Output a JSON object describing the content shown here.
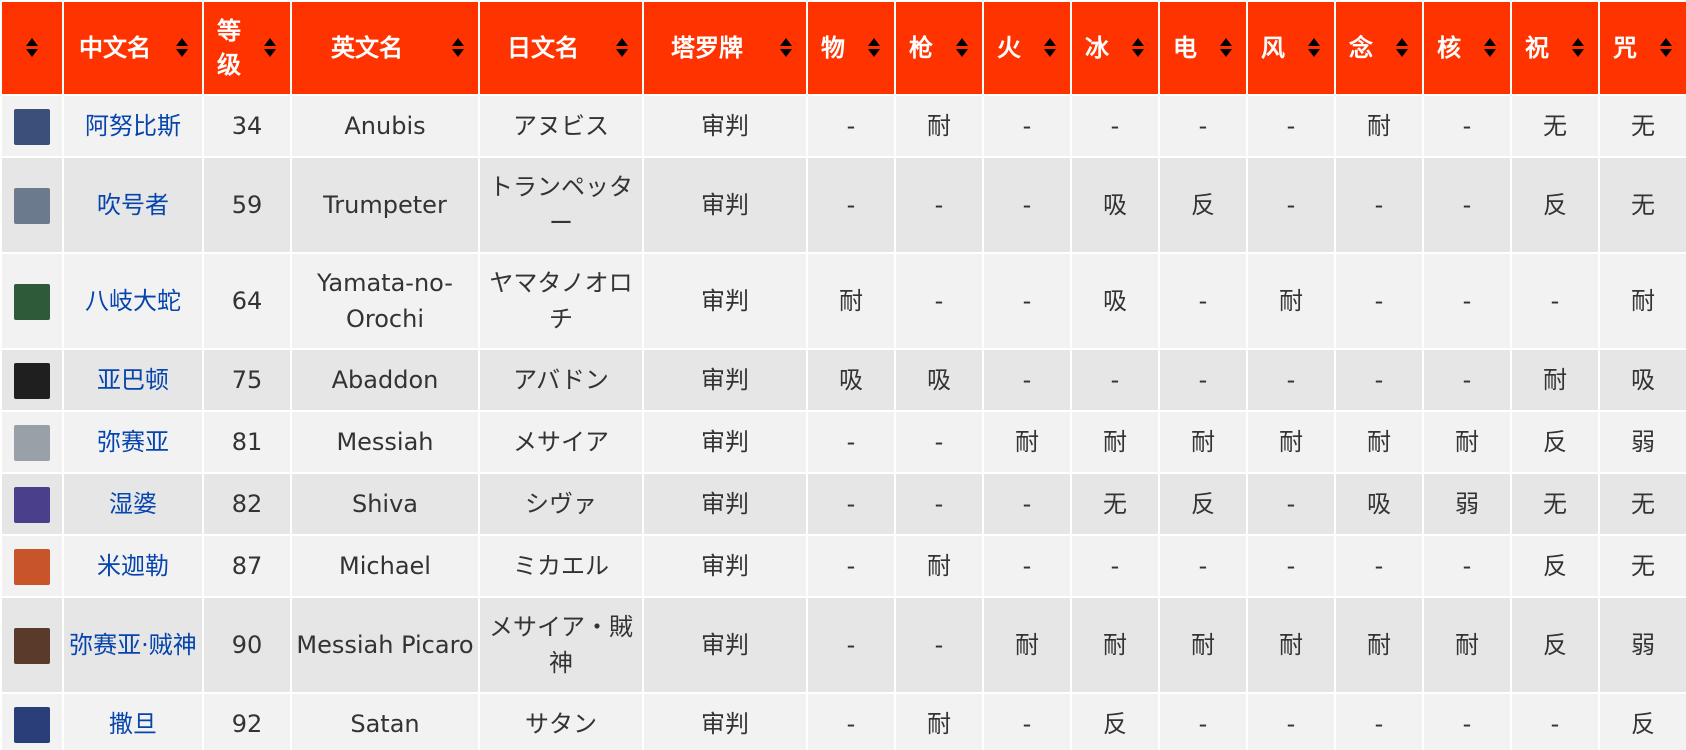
{
  "headers": {
    "cn_name": "中文名",
    "level": "等级",
    "en_name": "英文名",
    "jp_name": "日文名",
    "tarot": "塔罗牌",
    "phys": "物",
    "gun": "枪",
    "fire": "火",
    "ice": "冰",
    "elec": "电",
    "wind": "风",
    "psy": "念",
    "nuke": "核",
    "bless": "祝",
    "curse": "咒"
  },
  "icons": {
    "sort": "sort-both-icon",
    "portrait_colors": [
      "#3a4f7a",
      "#6b7a8c",
      "#2f5a3a",
      "#1f1f1f",
      "#9aa0a8",
      "#4a3f8a",
      "#c8552a",
      "#5a3a2a",
      "#2a3f7a"
    ]
  },
  "rows": [
    {
      "cn": "阿努比斯",
      "level": "34",
      "en": "Anubis",
      "jp": "アヌビス",
      "tarot": "审判",
      "phys": "-",
      "gun": "耐",
      "fire": "-",
      "ice": "-",
      "elec": "-",
      "wind": "-",
      "psy": "耐",
      "nuke": "-",
      "bless": "无",
      "curse": "无"
    },
    {
      "cn": "吹号者",
      "level": "59",
      "en": "Trumpeter",
      "jp": "トランペッター",
      "tarot": "审判",
      "phys": "-",
      "gun": "-",
      "fire": "-",
      "ice": "吸",
      "elec": "反",
      "wind": "-",
      "psy": "-",
      "nuke": "-",
      "bless": "反",
      "curse": "无"
    },
    {
      "cn": "八岐大蛇",
      "level": "64",
      "en": "Yamata-no-Orochi",
      "jp": "ヤマタノオロチ",
      "tarot": "审判",
      "phys": "耐",
      "gun": "-",
      "fire": "-",
      "ice": "吸",
      "elec": "-",
      "wind": "耐",
      "psy": "-",
      "nuke": "-",
      "bless": "-",
      "curse": "耐"
    },
    {
      "cn": "亚巴顿",
      "level": "75",
      "en": "Abaddon",
      "jp": "アバドン",
      "tarot": "审判",
      "phys": "吸",
      "gun": "吸",
      "fire": "-",
      "ice": "-",
      "elec": "-",
      "wind": "-",
      "psy": "-",
      "nuke": "-",
      "bless": "耐",
      "curse": "吸"
    },
    {
      "cn": "弥赛亚",
      "level": "81",
      "en": "Messiah",
      "jp": "メサイア",
      "tarot": "审判",
      "phys": "-",
      "gun": "-",
      "fire": "耐",
      "ice": "耐",
      "elec": "耐",
      "wind": "耐",
      "psy": "耐",
      "nuke": "耐",
      "bless": "反",
      "curse": "弱"
    },
    {
      "cn": "湿婆",
      "level": "82",
      "en": "Shiva",
      "jp": "シヴァ",
      "tarot": "审判",
      "phys": "-",
      "gun": "-",
      "fire": "-",
      "ice": "无",
      "elec": "反",
      "wind": "-",
      "psy": "吸",
      "nuke": "弱",
      "bless": "无",
      "curse": "无"
    },
    {
      "cn": "米迦勒",
      "level": "87",
      "en": "Michael",
      "jp": "ミカエル",
      "tarot": "审判",
      "phys": "-",
      "gun": "耐",
      "fire": "-",
      "ice": "-",
      "elec": "-",
      "wind": "-",
      "psy": "-",
      "nuke": "-",
      "bless": "反",
      "curse": "无"
    },
    {
      "cn": "弥赛亚·贼神",
      "level": "90",
      "en": "Messiah Picaro",
      "jp": "メサイア・賊神",
      "tarot": "审判",
      "phys": "-",
      "gun": "-",
      "fire": "耐",
      "ice": "耐",
      "elec": "耐",
      "wind": "耐",
      "psy": "耐",
      "nuke": "耐",
      "bless": "反",
      "curse": "弱"
    },
    {
      "cn": "撒旦",
      "level": "92",
      "en": "Satan",
      "jp": "サタン",
      "tarot": "审判",
      "phys": "-",
      "gun": "耐",
      "fire": "-",
      "ice": "反",
      "elec": "-",
      "wind": "-",
      "psy": "-",
      "nuke": "-",
      "bless": "-",
      "curse": "反"
    }
  ]
}
